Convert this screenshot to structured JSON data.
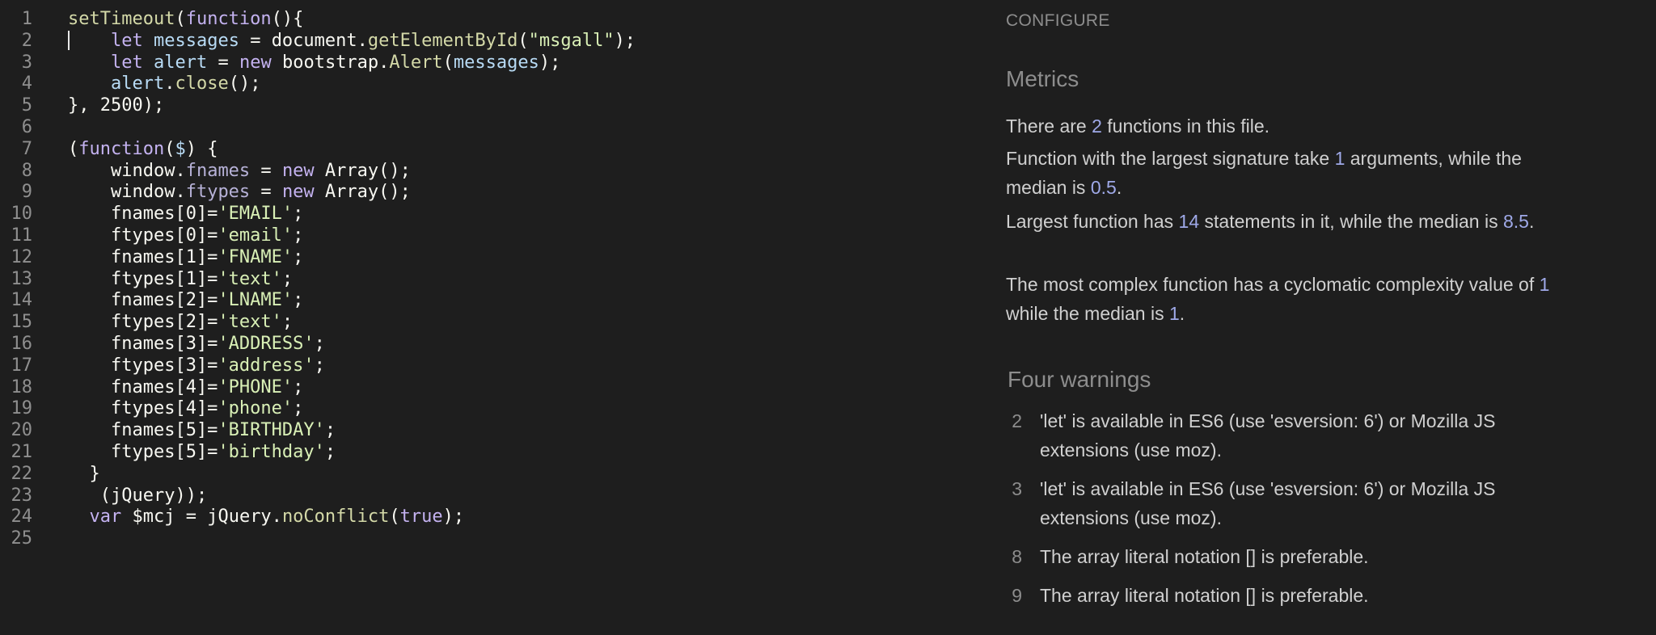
{
  "editor": {
    "lines": [
      {
        "n": "1",
        "parts": [
          [
            "fn",
            "setTimeout"
          ],
          [
            "",
            "("
          ],
          [
            "kw",
            "function"
          ],
          [
            "",
            "(){"
          ]
        ]
      },
      {
        "n": "2",
        "parts": [
          [
            "",
            "    "
          ],
          [
            "kw",
            "let"
          ],
          [
            "",
            " "
          ],
          [
            "var",
            "messages"
          ],
          [
            "",
            " = document."
          ],
          [
            "fn",
            "getElementById"
          ],
          [
            "",
            "("
          ],
          [
            "str",
            "\"msgall\""
          ],
          [
            "",
            ");"
          ]
        ]
      },
      {
        "n": "3",
        "parts": [
          [
            "",
            "    "
          ],
          [
            "kw",
            "let"
          ],
          [
            "",
            " "
          ],
          [
            "var",
            "alert"
          ],
          [
            "",
            " = "
          ],
          [
            "kw",
            "new"
          ],
          [
            "",
            " bootstrap."
          ],
          [
            "fn",
            "Alert"
          ],
          [
            "",
            "("
          ],
          [
            "var",
            "messages"
          ],
          [
            "",
            ");"
          ]
        ]
      },
      {
        "n": "4",
        "parts": [
          [
            "",
            "    "
          ],
          [
            "var",
            "alert"
          ],
          [
            "",
            "."
          ],
          [
            "fn",
            "close"
          ],
          [
            "",
            "();"
          ]
        ]
      },
      {
        "n": "5",
        "parts": [
          [
            "",
            "}, 2500);"
          ]
        ]
      },
      {
        "n": "6",
        "parts": []
      },
      {
        "n": "7",
        "parts": [
          [
            "",
            "("
          ],
          [
            "kw",
            "function"
          ],
          [
            "",
            "("
          ],
          [
            "var",
            "$"
          ],
          [
            "",
            ") {"
          ]
        ]
      },
      {
        "n": "8",
        "parts": [
          [
            "",
            "    window."
          ],
          [
            "prop",
            "fnames"
          ],
          [
            "",
            " = "
          ],
          [
            "kw",
            "new"
          ],
          [
            "",
            " Array();"
          ]
        ]
      },
      {
        "n": "9",
        "parts": [
          [
            "",
            "    window."
          ],
          [
            "prop",
            "ftypes"
          ],
          [
            "",
            " = "
          ],
          [
            "kw",
            "new"
          ],
          [
            "",
            " Array();"
          ]
        ]
      },
      {
        "n": "10",
        "parts": [
          [
            "",
            "    fnames[0]="
          ],
          [
            "str",
            "'EMAIL'"
          ],
          [
            "",
            ";"
          ]
        ]
      },
      {
        "n": "11",
        "parts": [
          [
            "",
            "    ftypes[0]="
          ],
          [
            "str",
            "'email'"
          ],
          [
            "",
            ";"
          ]
        ]
      },
      {
        "n": "12",
        "parts": [
          [
            "",
            "    fnames[1]="
          ],
          [
            "str",
            "'FNAME'"
          ],
          [
            "",
            ";"
          ]
        ]
      },
      {
        "n": "13",
        "parts": [
          [
            "",
            "    ftypes[1]="
          ],
          [
            "str",
            "'text'"
          ],
          [
            "",
            ";"
          ]
        ]
      },
      {
        "n": "14",
        "parts": [
          [
            "",
            "    fnames[2]="
          ],
          [
            "str",
            "'LNAME'"
          ],
          [
            "",
            ";"
          ]
        ]
      },
      {
        "n": "15",
        "parts": [
          [
            "",
            "    ftypes[2]="
          ],
          [
            "str",
            "'text'"
          ],
          [
            "",
            ";"
          ]
        ]
      },
      {
        "n": "16",
        "parts": [
          [
            "",
            "    fnames[3]="
          ],
          [
            "str",
            "'ADDRESS'"
          ],
          [
            "",
            ";"
          ]
        ]
      },
      {
        "n": "17",
        "parts": [
          [
            "",
            "    ftypes[3]="
          ],
          [
            "str",
            "'address'"
          ],
          [
            "",
            ";"
          ]
        ]
      },
      {
        "n": "18",
        "parts": [
          [
            "",
            "    fnames[4]="
          ],
          [
            "str",
            "'PHONE'"
          ],
          [
            "",
            ";"
          ]
        ]
      },
      {
        "n": "19",
        "parts": [
          [
            "",
            "    ftypes[4]="
          ],
          [
            "str",
            "'phone'"
          ],
          [
            "",
            ";"
          ]
        ]
      },
      {
        "n": "20",
        "parts": [
          [
            "",
            "    fnames[5]="
          ],
          [
            "str",
            "'BIRTHDAY'"
          ],
          [
            "",
            ";"
          ]
        ]
      },
      {
        "n": "21",
        "parts": [
          [
            "",
            "    ftypes[5]="
          ],
          [
            "str",
            "'birthday'"
          ],
          [
            "",
            ";"
          ]
        ]
      },
      {
        "n": "22",
        "parts": [
          [
            "",
            "  }"
          ]
        ]
      },
      {
        "n": "23",
        "parts": [
          [
            "",
            "   (jQuery));"
          ]
        ]
      },
      {
        "n": "24",
        "parts": [
          [
            "",
            "  "
          ],
          [
            "kw",
            "var"
          ],
          [
            "",
            " $mcj = jQuery."
          ],
          [
            "fn",
            "noConflict"
          ],
          [
            "",
            "("
          ],
          [
            "kw",
            "true"
          ],
          [
            "",
            ");"
          ]
        ]
      },
      {
        "n": "25",
        "parts": []
      }
    ]
  },
  "panel": {
    "configure_label": "CONFIGURE",
    "metrics_heading": "Metrics",
    "metrics": [
      {
        "parts": [
          [
            "t",
            "There are "
          ],
          [
            "n",
            "2"
          ],
          [
            "t",
            " functions in this file."
          ]
        ]
      },
      {
        "parts": [
          [
            "t",
            "Function with the largest signature take "
          ],
          [
            "n",
            "1"
          ],
          [
            "t",
            " arguments, while the median is "
          ],
          [
            "n",
            "0.5"
          ],
          [
            "t",
            "."
          ]
        ]
      },
      {
        "parts": [
          [
            "t",
            "Largest function has "
          ],
          [
            "n",
            "14"
          ],
          [
            "t",
            " statements in it, while the median is "
          ],
          [
            "n",
            "8.5"
          ],
          [
            "t",
            "."
          ]
        ]
      },
      {
        "parts": [
          [
            "t",
            "The most complex function has a cyclomatic complexity value of "
          ],
          [
            "n",
            "1"
          ],
          [
            "t",
            " while the median is "
          ],
          [
            "n",
            "1"
          ],
          [
            "t",
            "."
          ]
        ]
      }
    ],
    "warnings_heading": "Four warnings",
    "warnings": [
      {
        "line": "2",
        "message": "'let' is available in ES6 (use 'esversion: 6') or Mozilla JS extensions (use moz)."
      },
      {
        "line": "3",
        "message": "'let' is available in ES6 (use 'esversion: 6') or Mozilla JS extensions (use moz)."
      },
      {
        "line": "8",
        "message": "The array literal notation [] is preferable."
      },
      {
        "line": "9",
        "message": "The array literal notation [] is preferable."
      }
    ]
  }
}
